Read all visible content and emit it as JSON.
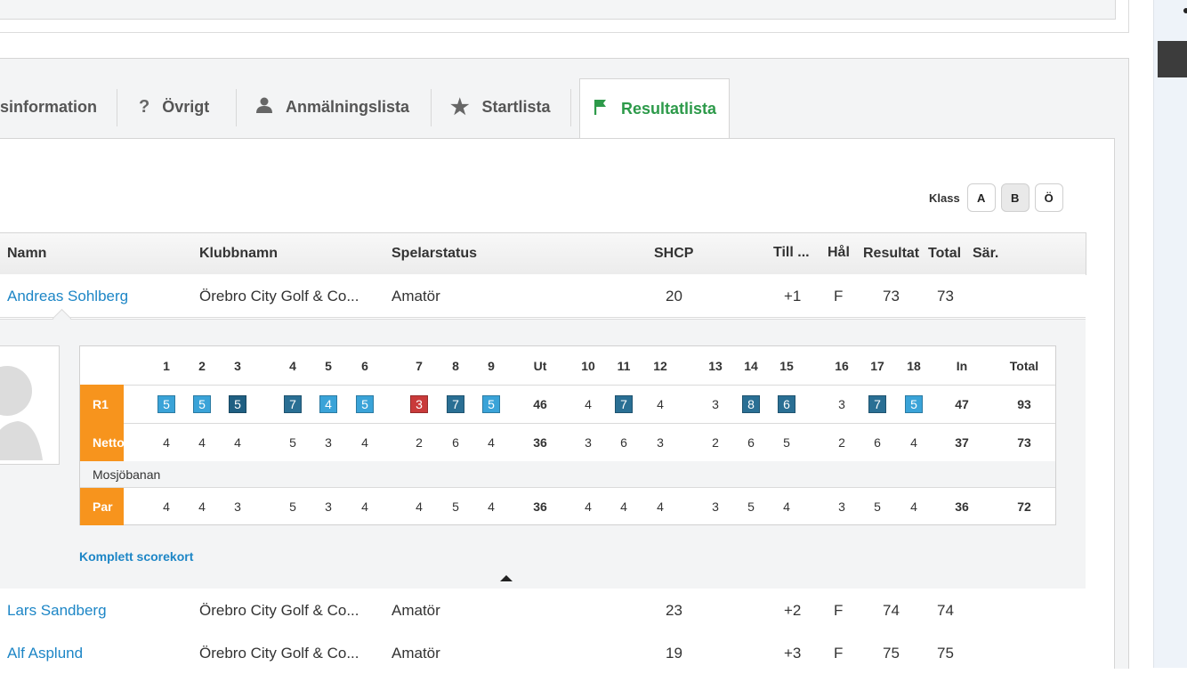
{
  "tabs": [
    {
      "label": "sinformation",
      "icon": ""
    },
    {
      "label": "Övrigt",
      "icon": "question-icon"
    },
    {
      "label": "Anmälningslista",
      "icon": "person-icon"
    },
    {
      "label": "Startlista",
      "icon": "star-icon"
    },
    {
      "label": "Resultatlista",
      "icon": "flag-icon",
      "active": true
    }
  ],
  "klass": {
    "label": "Klass",
    "options": [
      "A",
      "B",
      "Ö"
    ],
    "selected": "B"
  },
  "table": {
    "headers": {
      "namn": "Namn",
      "klubbnamn": "Klubbnamn",
      "spelarstatus": "Spelarstatus",
      "shcp": "SHCP",
      "till": "Till ...",
      "hal": "Hål",
      "resultat": "Resultat",
      "total": "Total",
      "sar": "Sär."
    },
    "rows": [
      {
        "namn": "Andreas Sohlberg",
        "klubbnamn": "Örebro City Golf & Co...",
        "spelarstatus": "Amatör",
        "shcp": "20",
        "till": "+1",
        "hal": "F",
        "resultat": "73",
        "total": "73"
      },
      {
        "namn": "Lars Sandberg",
        "klubbnamn": "Örebro City Golf & Co...",
        "spelarstatus": "Amatör",
        "shcp": "23",
        "till": "+2",
        "hal": "F",
        "resultat": "74",
        "total": "74"
      },
      {
        "namn": "Alf Asplund",
        "klubbnamn": "Örebro City Golf & Co...",
        "spelarstatus": "Amatör",
        "shcp": "19",
        "till": "+3",
        "hal": "F",
        "resultat": "75",
        "total": "75"
      }
    ]
  },
  "scorecard": {
    "columns": [
      "1",
      "2",
      "3",
      "4",
      "5",
      "6",
      "7",
      "8",
      "9",
      "Ut",
      "10",
      "11",
      "12",
      "13",
      "14",
      "15",
      "16",
      "17",
      "18",
      "In",
      "Total"
    ],
    "r1_label": "R1",
    "r1": [
      "5",
      "5",
      "5",
      "7",
      "4",
      "5",
      "3",
      "7",
      "5",
      "46",
      "4",
      "7",
      "4",
      "3",
      "8",
      "6",
      "3",
      "7",
      "5",
      "47",
      "93"
    ],
    "r1_styles": [
      "birdie",
      "birdie",
      "par-box",
      "double",
      "birdie",
      "birdie",
      "eagle",
      "double",
      "birdie",
      "",
      "",
      "double",
      "",
      "",
      "double",
      "double",
      "",
      "double",
      "birdie",
      "",
      ""
    ],
    "netto_label": "Netto",
    "netto": [
      "4",
      "4",
      "4",
      "5",
      "3",
      "4",
      "2",
      "6",
      "4",
      "36",
      "3",
      "6",
      "3",
      "2",
      "6",
      "5",
      "2",
      "6",
      "4",
      "37",
      "73"
    ],
    "course_name": "Mosjöbanan",
    "par_label": "Par",
    "par": [
      "4",
      "4",
      "3",
      "5",
      "3",
      "4",
      "4",
      "5",
      "4",
      "36",
      "4",
      "4",
      "4",
      "3",
      "5",
      "4",
      "3",
      "5",
      "4",
      "36",
      "72"
    ],
    "colors": {
      "birdie": "#3aa3d8",
      "par-box": "#1f5f82",
      "double": "#2a6f94",
      "eagle": "#c93a3a",
      "label": "#f7941d"
    }
  },
  "full_scorecard_link": "Komplett scorekort"
}
